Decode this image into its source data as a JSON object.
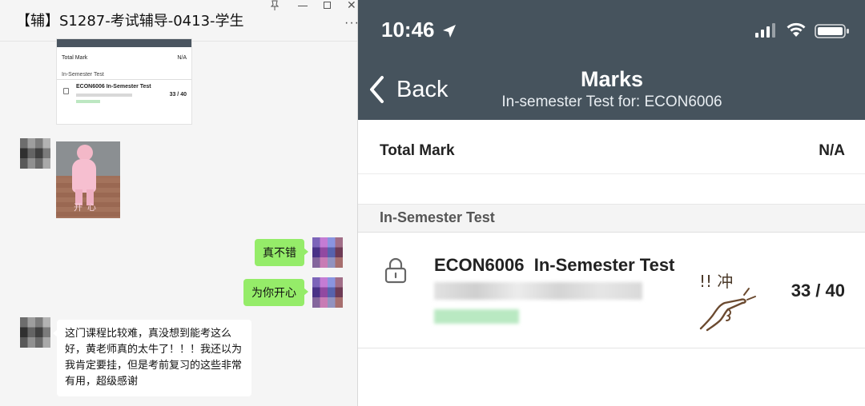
{
  "chat": {
    "title": "【辅】S1287-考试辅导-0413-学生",
    "more_glyph": "···",
    "thumbnail": {
      "total_label": "Total Mark",
      "total_value": "N/A",
      "section_label": "In-Semester Test",
      "test_title": "ECON6006  In-Semester Test",
      "score": "33 / 40"
    },
    "photo_caption": "开心",
    "messages": [
      {
        "side": "right",
        "text": "真不错"
      },
      {
        "side": "right",
        "text": "为你开心"
      },
      {
        "side": "left",
        "text": "这门课程比较难，真没想到能考这么好，黄老师真的太牛了！！！我还以为我肯定要挂，但是考前复习的这些非常有用，超级感谢"
      }
    ],
    "colors": {
      "bubble_self": "#95ec69",
      "bubble_other": "#ffffff",
      "background": "#f5f5f5"
    }
  },
  "phone": {
    "status": {
      "time": "10:46"
    },
    "nav": {
      "back_label": "Back",
      "title": "Marks",
      "subtitle": "In-semester Test for: ECON6006"
    },
    "total_mark": {
      "label": "Total Mark",
      "value": "N/A"
    },
    "section": {
      "label": "In-Semester Test"
    },
    "test": {
      "title": "ECON6006  In-Semester Test",
      "score": "33 / 40",
      "doodle_text": "!! 冲"
    },
    "colors": {
      "navbar": "#46535d",
      "section_bg": "#f4f4f4"
    }
  }
}
